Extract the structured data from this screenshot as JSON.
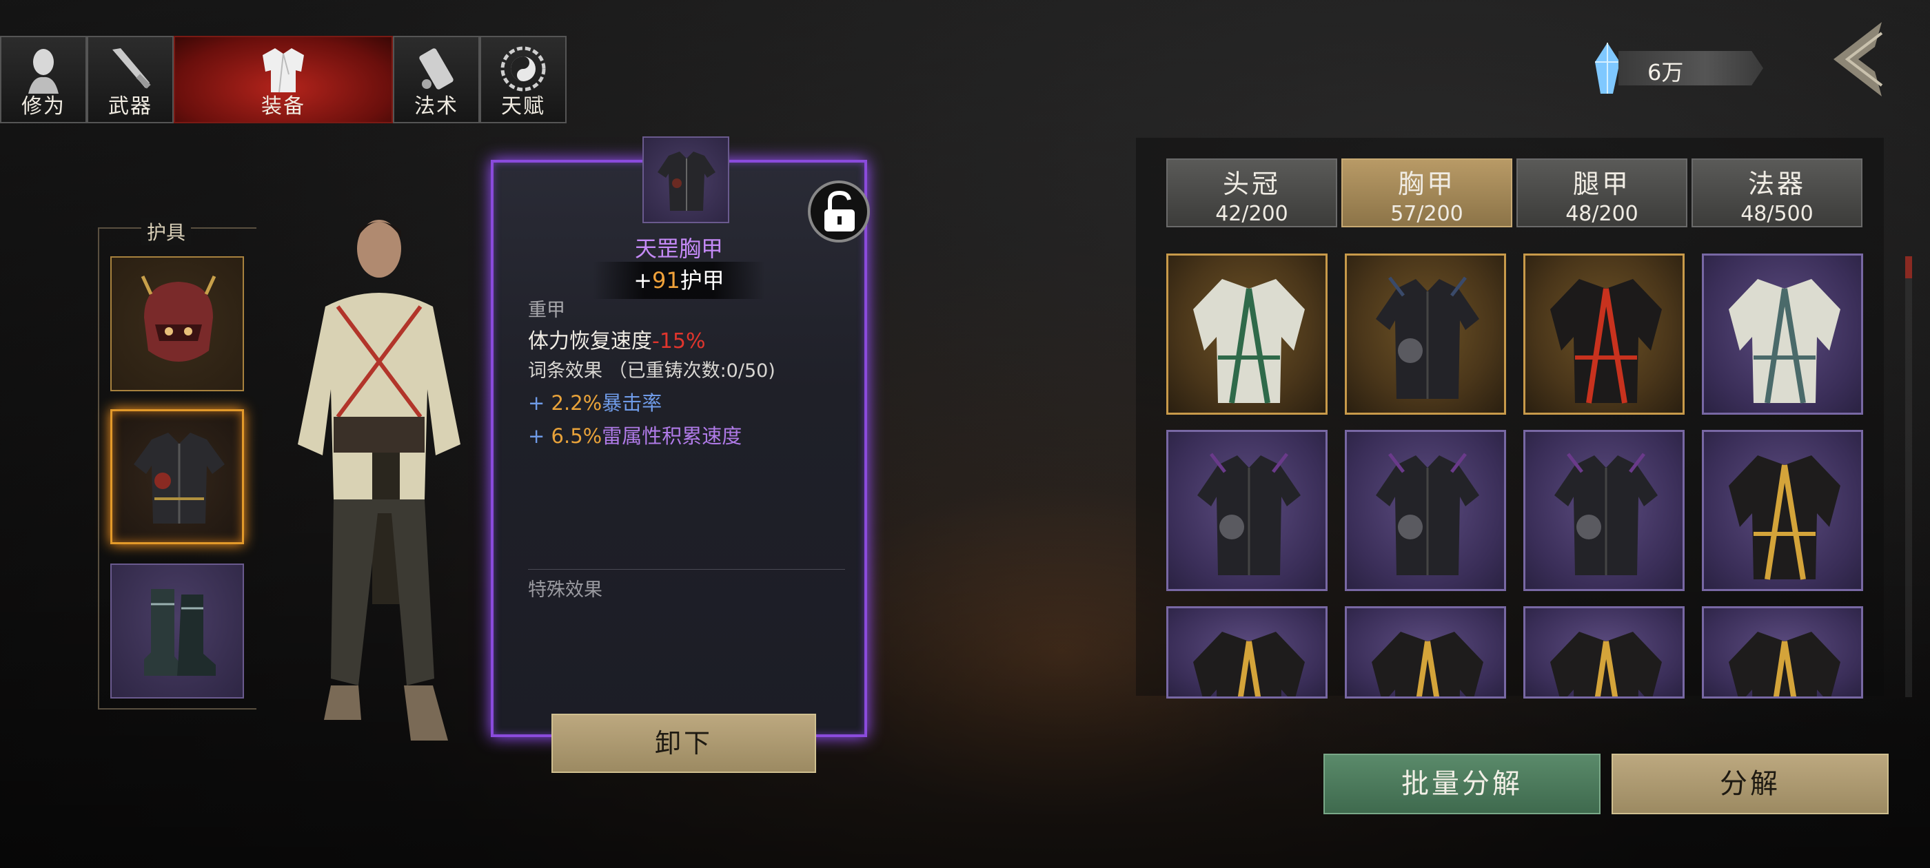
{
  "tabs": [
    {
      "label": "修为",
      "icon": "head-icon",
      "active": false
    },
    {
      "label": "武器",
      "icon": "weapon-icon",
      "active": false
    },
    {
      "label": "装备",
      "icon": "robe-icon",
      "active": true
    },
    {
      "label": "法术",
      "icon": "scroll-icon",
      "active": false
    },
    {
      "label": "天赋",
      "icon": "yin-yang-icon",
      "active": false
    }
  ],
  "currency": {
    "value": "6万",
    "icon": "crystal-icon"
  },
  "back_icon": "back-arrow-icon",
  "armor_slots": {
    "title": "护具",
    "items": [
      {
        "type": "helmet",
        "rarity": "gold",
        "selected": false
      },
      {
        "type": "chest-armor",
        "rarity": "gold",
        "selected": true
      },
      {
        "type": "boots",
        "rarity": "purple",
        "selected": false
      }
    ]
  },
  "detail": {
    "name": "天罡胸甲",
    "stat_prefix": "+",
    "stat_value": "91",
    "stat_name": "护甲",
    "type": "重甲",
    "penalty_label": "体力恢复速度",
    "penalty_value": "-15%",
    "affix_header": "词条效果 （已重铸次数:0/50)",
    "affixes": [
      {
        "prefix": "+ ",
        "value": "2.2%",
        "name": "暴击率"
      },
      {
        "prefix": "+ ",
        "value": "6.5%",
        "name": "雷属性积累速度"
      }
    ],
    "special_header": "特殊效果",
    "unequip_label": "卸下",
    "locked": false
  },
  "categories": [
    {
      "name": "头冠",
      "count": "42/200",
      "active": false
    },
    {
      "name": "胸甲",
      "count": "57/200",
      "active": true
    },
    {
      "name": "腿甲",
      "count": "48/200",
      "active": false
    },
    {
      "name": "法器",
      "count": "48/500",
      "active": false
    }
  ],
  "inventory": [
    {
      "rarity": "gold",
      "style": "robe-green",
      "accent": "#2f6a4a"
    },
    {
      "rarity": "gold",
      "style": "armor-dark",
      "accent": "#3a4a6a"
    },
    {
      "rarity": "gold",
      "style": "robe-red",
      "accent": "#c8321e"
    },
    {
      "rarity": "purple",
      "style": "robe-teal",
      "accent": "#4a6a6a"
    },
    {
      "rarity": "purple",
      "style": "armor-dark",
      "accent": "#6a3a8a"
    },
    {
      "rarity": "purple",
      "style": "armor-dark",
      "accent": "#6a3a8a"
    },
    {
      "rarity": "purple",
      "style": "armor-dark",
      "accent": "#6a3a8a"
    },
    {
      "rarity": "purple",
      "style": "robe-gold",
      "accent": "#d4a43a"
    },
    {
      "rarity": "purple",
      "style": "robe-gold",
      "accent": "#d4a43a"
    },
    {
      "rarity": "purple",
      "style": "robe-gold",
      "accent": "#d4a43a"
    },
    {
      "rarity": "purple",
      "style": "robe-gold",
      "accent": "#d4a43a"
    },
    {
      "rarity": "purple",
      "style": "robe-gold",
      "accent": "#d4a43a"
    }
  ],
  "actions": {
    "batch_label": "批量分解",
    "disassemble_label": "分解"
  }
}
